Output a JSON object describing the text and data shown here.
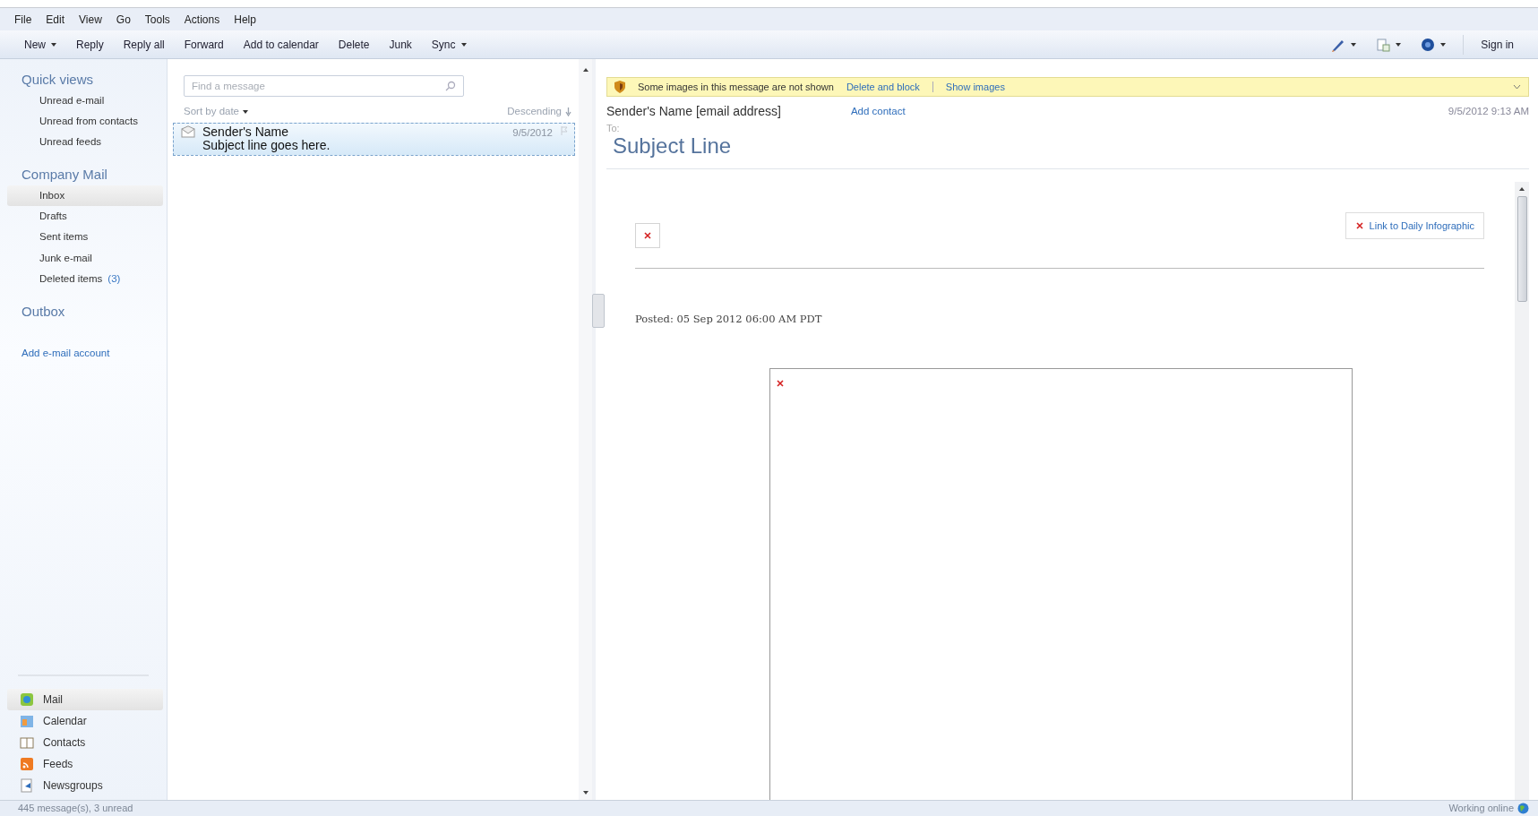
{
  "menu": [
    "File",
    "Edit",
    "View",
    "Go",
    "Tools",
    "Actions",
    "Help"
  ],
  "toolbar": [
    {
      "label": "New",
      "dropdown": true
    },
    {
      "label": "Reply",
      "dropdown": false
    },
    {
      "label": "Reply all",
      "dropdown": false
    },
    {
      "label": "Forward",
      "dropdown": false
    },
    {
      "label": "Add to calendar",
      "dropdown": false
    },
    {
      "label": "Delete",
      "dropdown": false
    },
    {
      "label": "Junk",
      "dropdown": false
    },
    {
      "label": "Sync",
      "dropdown": true
    }
  ],
  "toolbar_right": {
    "tools": [
      {
        "kind": "pen",
        "dropdown": true
      },
      {
        "kind": "layout",
        "dropdown": true
      },
      {
        "kind": "help",
        "dropdown": true
      }
    ],
    "sign_in": "Sign in"
  },
  "sidebar": {
    "sections": [
      {
        "title": "Quick views",
        "items": [
          {
            "label": "Unread e-mail",
            "selected": false
          },
          {
            "label": "Unread from contacts",
            "selected": false
          },
          {
            "label": "Unread feeds",
            "selected": false
          }
        ]
      },
      {
        "title": "Company Mail",
        "items": [
          {
            "label": "Inbox",
            "selected": true
          },
          {
            "label": "Drafts",
            "selected": false
          },
          {
            "label": "Sent items",
            "selected": false
          },
          {
            "label": "Junk e-mail",
            "selected": false
          },
          {
            "label": "Deleted items",
            "count": "(3)",
            "selected": false
          }
        ]
      },
      {
        "title": "Outbox"
      }
    ],
    "add_account": "Add e-mail account",
    "nav": [
      {
        "label": "Mail",
        "kind": "mail",
        "selected": true
      },
      {
        "label": "Calendar",
        "kind": "calendar",
        "selected": false
      },
      {
        "label": "Contacts",
        "kind": "contacts",
        "selected": false
      },
      {
        "label": "Feeds",
        "kind": "feeds",
        "selected": false
      },
      {
        "label": "Newsgroups",
        "kind": "newsgroups",
        "selected": false
      }
    ]
  },
  "message_list": {
    "search": {
      "placeholder": "Find a message"
    },
    "sort": "Sort by date",
    "order": "Descending",
    "messages": [
      {
        "sender": "Sender's Name",
        "subject": "Subject line goes here.",
        "date": "9/5/2012",
        "selected": true
      }
    ]
  },
  "reading_pane": {
    "infobar": {
      "text": "Some images in this message are not shown",
      "actions": [
        "Delete and block",
        "Show images"
      ]
    },
    "sender": "Sender's Name [email address]",
    "add_contact": "Add contact",
    "date": "9/5/2012 9:13 AM",
    "to": "To:",
    "subject": "Subject Line",
    "body": {
      "link": "Link to Daily Infographic",
      "posted": "Posted: 05 Sep 2012 06:00 AM PDT"
    }
  },
  "status_bar": {
    "left": "445 message(s), 3 unread",
    "right": "Working online"
  }
}
